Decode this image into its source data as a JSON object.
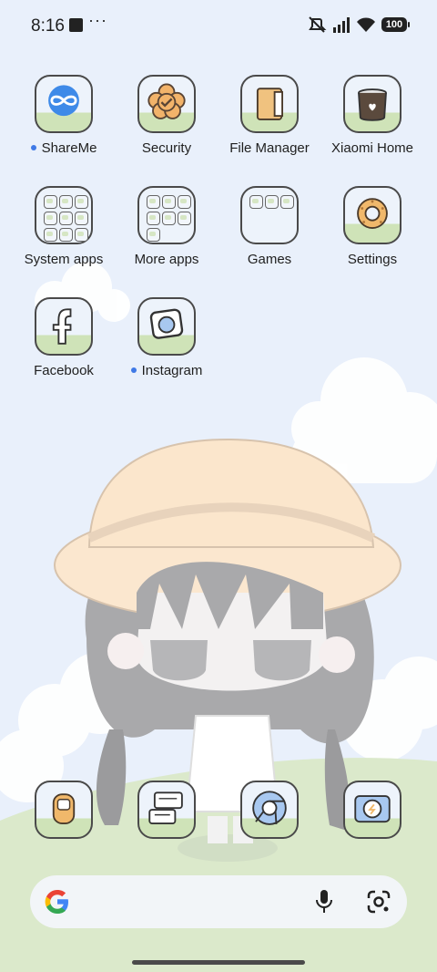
{
  "status_bar": {
    "time": "8:16",
    "dots": "···",
    "battery": "100",
    "icons": [
      "notification-square-icon",
      "vibrate-mute-icon",
      "signal-icon",
      "wifi-icon",
      "battery-icon"
    ]
  },
  "apps": [
    {
      "label": "ShareMe",
      "icon": "shareme-icon",
      "new": true
    },
    {
      "label": "Security",
      "icon": "security-icon",
      "new": false
    },
    {
      "label": "File Manager",
      "icon": "file-manager-icon",
      "new": false
    },
    {
      "label": "Xiaomi Home",
      "icon": "xiaomi-home-icon",
      "new": false
    },
    {
      "label": "System apps",
      "icon": "folder-icon",
      "new": false
    },
    {
      "label": "More apps",
      "icon": "folder-icon",
      "new": false
    },
    {
      "label": "Games",
      "icon": "folder-icon",
      "new": false
    },
    {
      "label": "Settings",
      "icon": "settings-icon",
      "new": false
    },
    {
      "label": "Facebook",
      "icon": "facebook-icon",
      "new": false
    },
    {
      "label": "Instagram",
      "icon": "instagram-icon",
      "new": true
    }
  ],
  "dock": [
    "phone-icon",
    "messages-icon",
    "chrome-icon",
    "camera-icon"
  ],
  "search": {
    "icons": [
      "google-icon",
      "microphone-icon",
      "lens-icon"
    ]
  },
  "colors": {
    "accent_dot": "#3f79e6",
    "background": "#e9f0fb",
    "grass": "#cfe3b8"
  }
}
